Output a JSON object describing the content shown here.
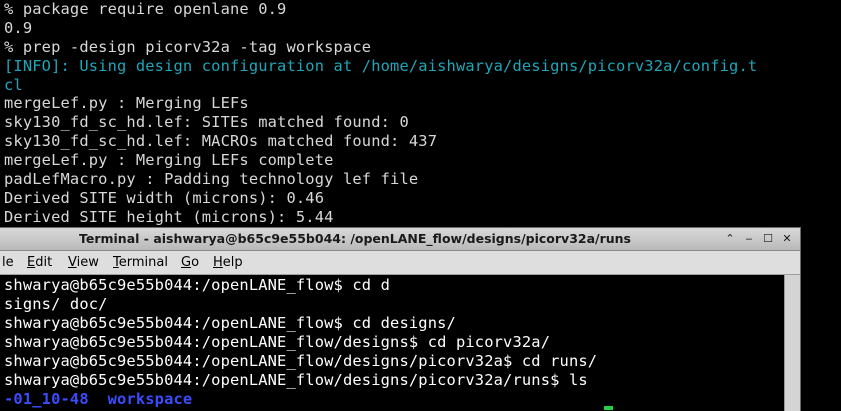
{
  "background_terminal": {
    "lines": [
      {
        "text": "% package require openlane 0.9",
        "kind": "normal"
      },
      {
        "text": "0.9",
        "kind": "normal"
      },
      {
        "text": "% prep -design picorv32a -tag workspace",
        "kind": "normal"
      },
      {
        "text": "[INFO]: Using design configuration at /home/aishwarya/designs/picorv32a/config.t",
        "kind": "info"
      },
      {
        "text": "cl",
        "kind": "info"
      },
      {
        "text": "mergeLef.py : Merging LEFs",
        "kind": "normal"
      },
      {
        "text": "sky130_fd_sc_hd.lef: SITEs matched found: 0",
        "kind": "normal"
      },
      {
        "text": "sky130_fd_sc_hd.lef: MACROs matched found: 437",
        "kind": "normal"
      },
      {
        "text": "mergeLef.py : Merging LEFs complete",
        "kind": "normal"
      },
      {
        "text": "padLefMacro.py : Padding technology lef file",
        "kind": "normal"
      },
      {
        "text": "Derived SITE width (microns): 0.46",
        "kind": "normal"
      },
      {
        "text": "Derived SITE height (microns): 5.44",
        "kind": "normal"
      }
    ]
  },
  "terminal_window": {
    "title": "Terminal - aishwarya@b65c9e55b044: /openLANE_flow/designs/picorv32a/runs",
    "buttons": {
      "menu": "⌃",
      "minimize": "‒",
      "maximize": "☐",
      "close": "✕"
    },
    "menu": [
      {
        "mnemonic": "",
        "rest": "le"
      },
      {
        "mnemonic": "E",
        "rest": "dit"
      },
      {
        "mnemonic": "V",
        "rest": "iew"
      },
      {
        "mnemonic": "T",
        "rest": "erminal"
      },
      {
        "mnemonic": "G",
        "rest": "o"
      },
      {
        "mnemonic": "H",
        "rest": "elp"
      }
    ],
    "lines": [
      {
        "text": "shwarya@b65c9e55b044:/openLANE_flow$ cd d"
      },
      {
        "text": "signs/ doc/"
      },
      {
        "text": "shwarya@b65c9e55b044:/openLANE_flow$ cd designs/"
      },
      {
        "text": "shwarya@b65c9e55b044:/openLANE_flow/designs$ cd picorv32a/"
      },
      {
        "text": "shwarya@b65c9e55b044:/openLANE_flow/designs/picorv32a$ cd runs/"
      },
      {
        "text": "shwarya@b65c9e55b044:/openLANE_flow/designs/picorv32a/runs$ ls"
      }
    ],
    "ls_output": [
      "-01_10-48",
      "workspace"
    ]
  },
  "colors": {
    "info": "#1fa6b8",
    "dir": "#3b4cff",
    "cursor": "#22d04a"
  }
}
